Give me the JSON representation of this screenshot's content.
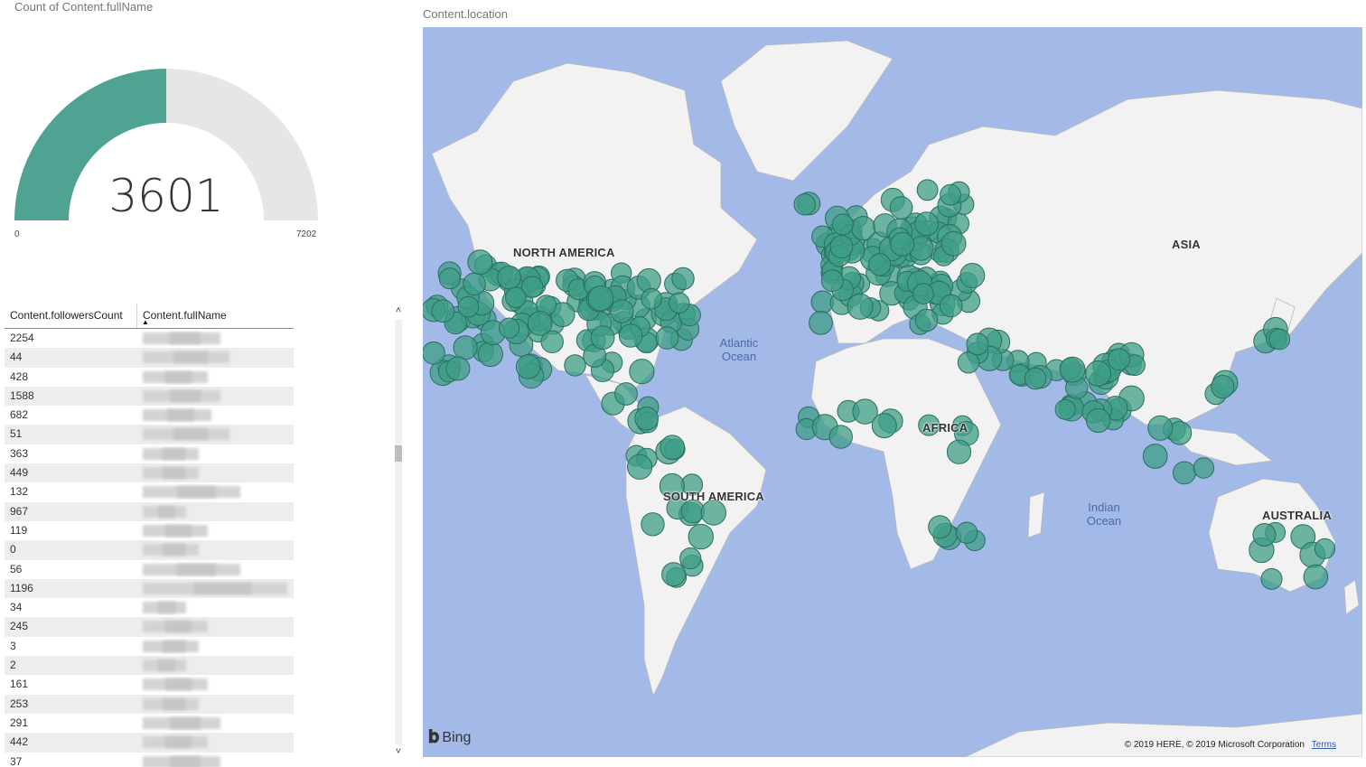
{
  "gauge": {
    "title": "Count of Content.fullName",
    "value": "3601",
    "min": "0",
    "max": "7202",
    "value_num": 3601,
    "max_num": 7202,
    "fill_color": "#4fa393",
    "track_color": "#e6e6e6"
  },
  "table": {
    "headers": [
      "Content.followersCount",
      "Content.fullName"
    ],
    "sorted_column": "Content.fullName",
    "rows": [
      "2254",
      "44",
      "428",
      "1588",
      "682",
      "51",
      "363",
      "449",
      "132",
      "967",
      "119",
      "0",
      "56",
      "1196",
      "34",
      "245",
      "3",
      "2",
      "161",
      "253",
      "291",
      "442",
      "37"
    ]
  },
  "map": {
    "title": "Content.location",
    "continents": [
      "NORTH AMERICA",
      "SOUTH AMERICA",
      "AFRICA",
      "ASIA",
      "AUSTRALIA"
    ],
    "oceans": [
      "Atlantic\nOcean",
      "Indian\nOcean"
    ],
    "bing": "Bing",
    "copyright": "© 2019 HERE, © 2019 Microsoft Corporation",
    "terms": "Terms",
    "bubble_color": "#3f9d87",
    "land_color": "#f2f2f2",
    "water_color": "#a3b9e8"
  }
}
